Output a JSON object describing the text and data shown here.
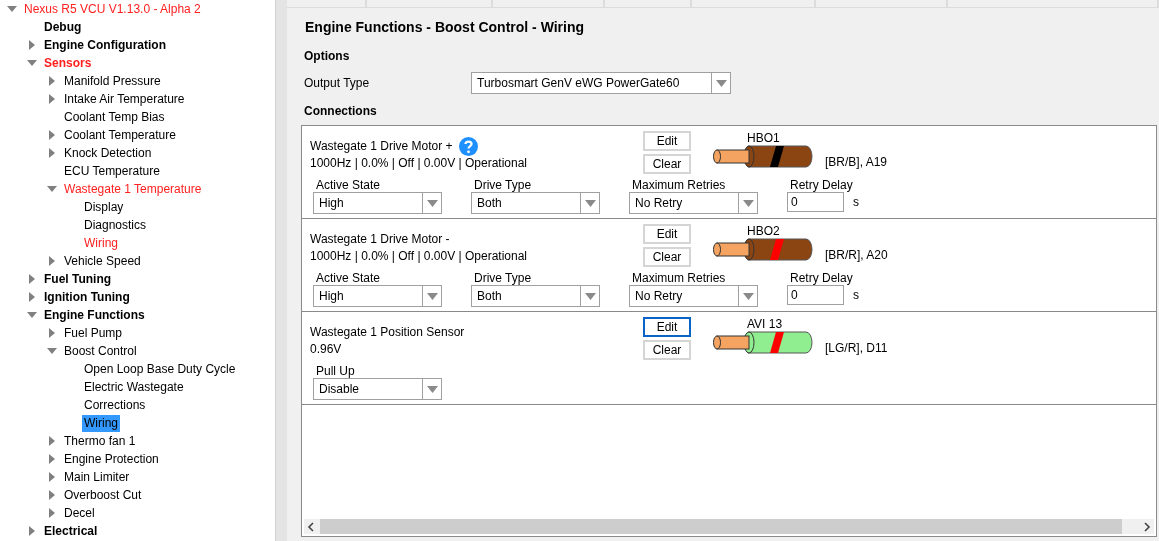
{
  "tree": [
    {
      "label": "Nexus R5 VCU V1.13.0 - Alpha 2",
      "kind": "branch",
      "expanded": true,
      "highlighted": true,
      "selected": false,
      "children": [
        {
          "label": "Debug",
          "kind": "leaf",
          "highlighted": false,
          "selected": false
        },
        {
          "label": "Engine Configuration",
          "kind": "branch",
          "expanded": false,
          "highlighted": false,
          "selected": false
        },
        {
          "label": "Sensors",
          "kind": "branch",
          "expanded": true,
          "highlighted": true,
          "selected": false,
          "children": [
            {
              "label": "Manifold Pressure",
              "kind": "branch",
              "expanded": false,
              "highlighted": false,
              "selected": false
            },
            {
              "label": "Intake Air Temperature",
              "kind": "branch",
              "expanded": false,
              "highlighted": false,
              "selected": false
            },
            {
              "label": "Coolant Temp Bias",
              "kind": "leaf",
              "highlighted": false,
              "selected": false
            },
            {
              "label": "Coolant Temperature",
              "kind": "branch",
              "expanded": false,
              "highlighted": false,
              "selected": false
            },
            {
              "label": "Knock Detection",
              "kind": "branch",
              "expanded": false,
              "highlighted": false,
              "selected": false
            },
            {
              "label": "ECU Temperature",
              "kind": "leaf",
              "highlighted": false,
              "selected": false
            },
            {
              "label": "Wastegate 1 Temperature",
              "kind": "branch",
              "expanded": true,
              "highlighted": true,
              "selected": false,
              "children": [
                {
                  "label": "Display",
                  "kind": "leaf",
                  "highlighted": false,
                  "selected": false
                },
                {
                  "label": "Diagnostics",
                  "kind": "leaf",
                  "highlighted": false,
                  "selected": false
                },
                {
                  "label": "Wiring",
                  "kind": "leaf",
                  "highlighted": true,
                  "selected": false
                }
              ]
            },
            {
              "label": "Vehicle Speed",
              "kind": "branch",
              "expanded": false,
              "highlighted": false,
              "selected": false
            }
          ]
        },
        {
          "label": "Fuel Tuning",
          "kind": "branch",
          "expanded": false,
          "highlighted": false,
          "selected": false
        },
        {
          "label": "Ignition Tuning",
          "kind": "branch",
          "expanded": false,
          "highlighted": false,
          "selected": false
        },
        {
          "label": "Engine Functions",
          "kind": "branch",
          "expanded": true,
          "highlighted": false,
          "selected": false,
          "children": [
            {
              "label": "Fuel Pump",
              "kind": "branch",
              "expanded": false,
              "highlighted": false,
              "selected": false
            },
            {
              "label": "Boost Control",
              "kind": "branch",
              "expanded": true,
              "highlighted": false,
              "selected": false,
              "children": [
                {
                  "label": "Open Loop Base Duty Cycle",
                  "kind": "leaf",
                  "highlighted": false,
                  "selected": false
                },
                {
                  "label": "Electric Wastegate",
                  "kind": "leaf",
                  "highlighted": false,
                  "selected": false
                },
                {
                  "label": "Corrections",
                  "kind": "leaf",
                  "highlighted": false,
                  "selected": false
                },
                {
                  "label": "Wiring",
                  "kind": "leaf",
                  "highlighted": false,
                  "selected": true
                }
              ]
            },
            {
              "label": "Thermo fan 1",
              "kind": "branch",
              "expanded": false,
              "highlighted": false,
              "selected": false
            },
            {
              "label": "Engine Protection",
              "kind": "branch",
              "expanded": false,
              "highlighted": false,
              "selected": false
            },
            {
              "label": "Main Limiter",
              "kind": "branch",
              "expanded": false,
              "highlighted": false,
              "selected": false
            },
            {
              "label": "Overboost Cut",
              "kind": "branch",
              "expanded": false,
              "highlighted": false,
              "selected": false
            },
            {
              "label": "Decel",
              "kind": "branch",
              "expanded": false,
              "highlighted": false,
              "selected": false
            }
          ]
        },
        {
          "label": "Electrical",
          "kind": "branch",
          "expanded": false,
          "highlighted": false,
          "selected": false
        }
      ]
    }
  ],
  "page": {
    "title": "Engine Functions - Boost Control - Wiring",
    "options_heading": "Options",
    "output_type": {
      "label": "Output Type",
      "value": "Turbosmart GenV eWG PowerGate60"
    },
    "connections_heading": "Connections",
    "connections": [
      {
        "name": "Wastegate 1 Drive Motor +",
        "help": true,
        "status": "1000Hz | 0.0% | Off | 0.00V | Operational",
        "edit": "Edit",
        "clear": "Clear",
        "edit_focused": false,
        "wire": {
          "label": "HBO1",
          "color": "#8b4513",
          "stripe": {
            "color": "#000000"
          },
          "code": "[BR/B], A19"
        },
        "fields": [
          {
            "kind": "select",
            "label": "Active State",
            "value": "High"
          },
          {
            "kind": "select",
            "label": "Drive Type",
            "value": "Both"
          },
          {
            "kind": "select",
            "label": "Maximum Retries",
            "value": "No Retry"
          },
          {
            "kind": "number",
            "label": "Retry Delay",
            "value": "0",
            "unit": "s"
          }
        ]
      },
      {
        "name": "Wastegate 1 Drive Motor -",
        "help": false,
        "status": "1000Hz | 0.0% | Off | 0.00V | Operational",
        "edit": "Edit",
        "clear": "Clear",
        "edit_focused": false,
        "wire": {
          "label": "HBO2",
          "color": "#8b4513",
          "stripe": {
            "color": "#ff0000"
          },
          "code": "[BR/R], A20"
        },
        "fields": [
          {
            "kind": "select",
            "label": "Active State",
            "value": "High"
          },
          {
            "kind": "select",
            "label": "Drive Type",
            "value": "Both"
          },
          {
            "kind": "select",
            "label": "Maximum Retries",
            "value": "No Retry"
          },
          {
            "kind": "number",
            "label": "Retry Delay",
            "value": "0",
            "unit": "s"
          }
        ]
      },
      {
        "name": "Wastegate 1 Position Sensor",
        "help": false,
        "status": "0.96V",
        "edit": "Edit",
        "clear": "Clear",
        "edit_focused": true,
        "wire": {
          "label": "AVI 13",
          "color": "#90ee90",
          "stripe": {
            "color": "#ff0000"
          },
          "code": "[LG/R], D11"
        },
        "fields": [
          {
            "kind": "select",
            "label": "Pull Up",
            "value": "Disable"
          }
        ]
      }
    ]
  }
}
